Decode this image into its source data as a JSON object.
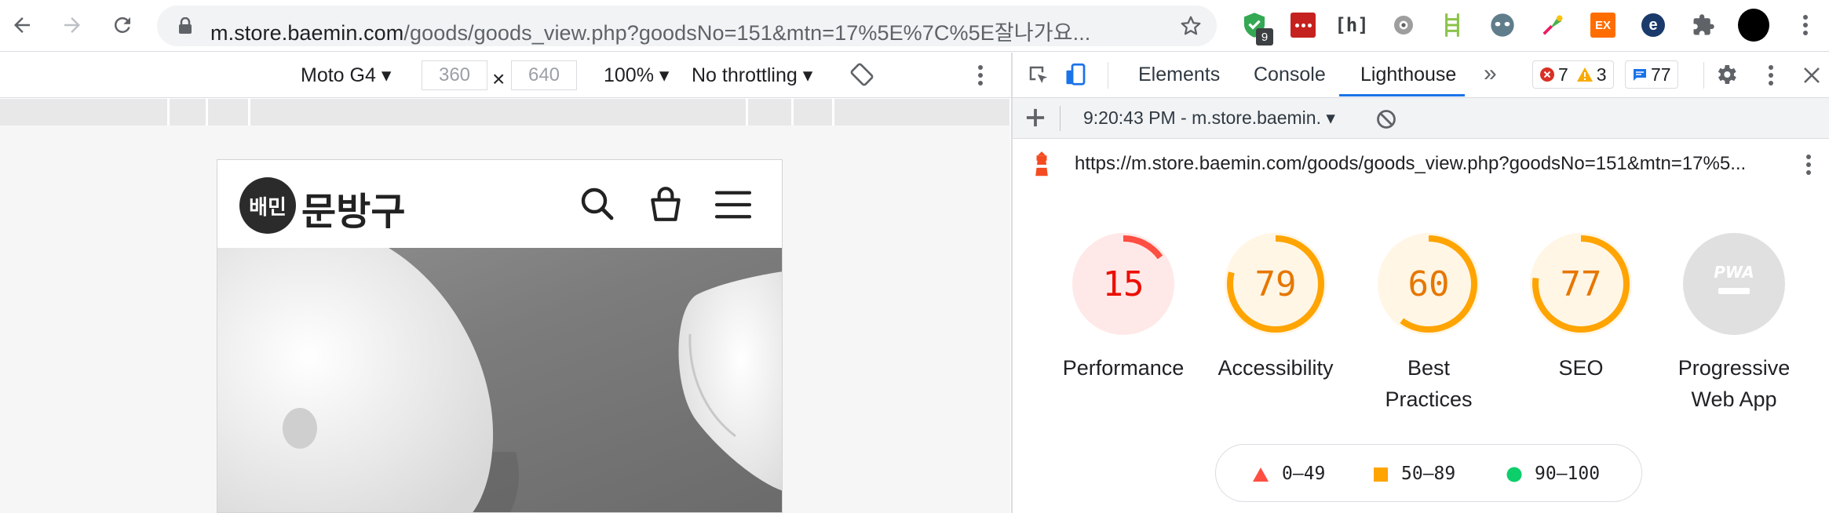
{
  "browser": {
    "url_host": "m.store.baemin.com",
    "url_path": "/goods/goods_view.php?goodsNo=151&mtn=17%5E%7C%5E잘나가요...",
    "extension_badge": "9"
  },
  "device_toolbar": {
    "device": "Moto G4",
    "width": "360",
    "times": "×",
    "height": "640",
    "zoom": "100%",
    "throttling": "No throttling"
  },
  "phone": {
    "logo_badge": "배민",
    "logo_text": "문방구"
  },
  "devtools": {
    "tabs": [
      {
        "label": "Elements"
      },
      {
        "label": "Console"
      },
      {
        "label": "Lighthouse"
      }
    ],
    "more_tabs": "»",
    "errors": "7",
    "warnings": "3",
    "messages": "77",
    "report_selector": "9:20:43 PM - m.store.baemin.",
    "report_url": "https://m.store.baemin.com/goods/goods_view.php?goodsNo=151&mtn=17%5..."
  },
  "lighthouse": {
    "scores": [
      {
        "label_1": "Performance",
        "label_2": "",
        "score": 15,
        "color": "#ff4e42",
        "bg": "#ffe9e8"
      },
      {
        "label_1": "Accessibility",
        "label_2": "",
        "score": 79,
        "color": "#ffa400",
        "bg": "#fff6e6"
      },
      {
        "label_1": "Best",
        "label_2": "Practices",
        "score": 60,
        "color": "#ffa400",
        "bg": "#fff6e6"
      },
      {
        "label_1": "SEO",
        "label_2": "",
        "score": 77,
        "color": "#ffa400",
        "bg": "#fff6e6"
      },
      {
        "label_1": "Progressive",
        "label_2": "Web App",
        "score": null,
        "color": "#e0e0e0",
        "bg": "#e0e0e0"
      }
    ],
    "pwa_badge": "PWA",
    "legend": [
      {
        "range": "0–49",
        "color": "#ff4e42"
      },
      {
        "range": "50–89",
        "color": "#ffa400"
      },
      {
        "range": "90–100",
        "color": "#0cce6b"
      }
    ]
  }
}
